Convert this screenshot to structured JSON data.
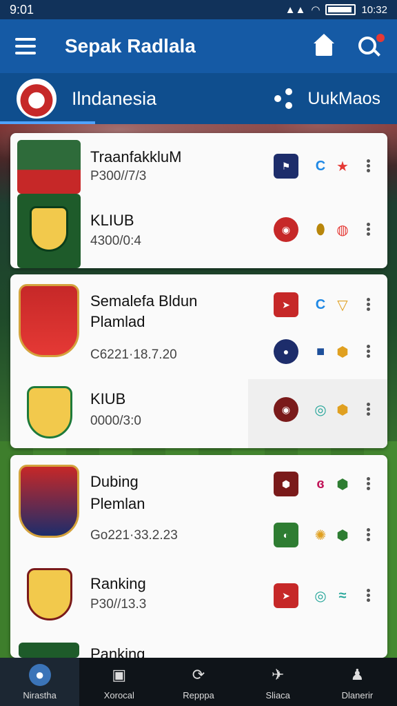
{
  "status_bar": {
    "time_left": "9:01",
    "time_right": "10:32"
  },
  "app_bar": {
    "title": "Sepak Radlala"
  },
  "country_bar": {
    "country": "Ilndanesia",
    "right_label": "UukMaos"
  },
  "cards": [
    {
      "rows": [
        {
          "title": "TraanfakkluM",
          "sub": "P300//7/3"
        },
        {
          "title": "KLIUB",
          "sub": "4300/0:4"
        }
      ]
    },
    {
      "rows": [
        {
          "title": "Semalefa Bldun",
          "title2": "Plamlad",
          "sub": "C6221·18.7.20"
        },
        {
          "title": "KIUB",
          "sub": "0000/3:0"
        }
      ]
    },
    {
      "rows": [
        {
          "title": "Dubing",
          "title2": "Plemlan",
          "sub": "Go221·33.2.23"
        },
        {
          "title": "Ranking",
          "sub": "P30//13.3"
        },
        {
          "title": "Panking"
        }
      ]
    }
  ],
  "bottom_nav": [
    {
      "label": "Nirastha",
      "icon": "person-icon"
    },
    {
      "label": "Xorocal",
      "icon": "square-icon"
    },
    {
      "label": "Repppa",
      "icon": "refresh-icon"
    },
    {
      "label": "Sliaca",
      "icon": "plane-icon"
    },
    {
      "label": "Dlanerir",
      "icon": "user-icon"
    }
  ],
  "colors": {
    "app_bar": "#155aa5",
    "country_bar": "#0f4e8e",
    "accent_red": "#e53935",
    "nav_bg": "#0f1419"
  }
}
